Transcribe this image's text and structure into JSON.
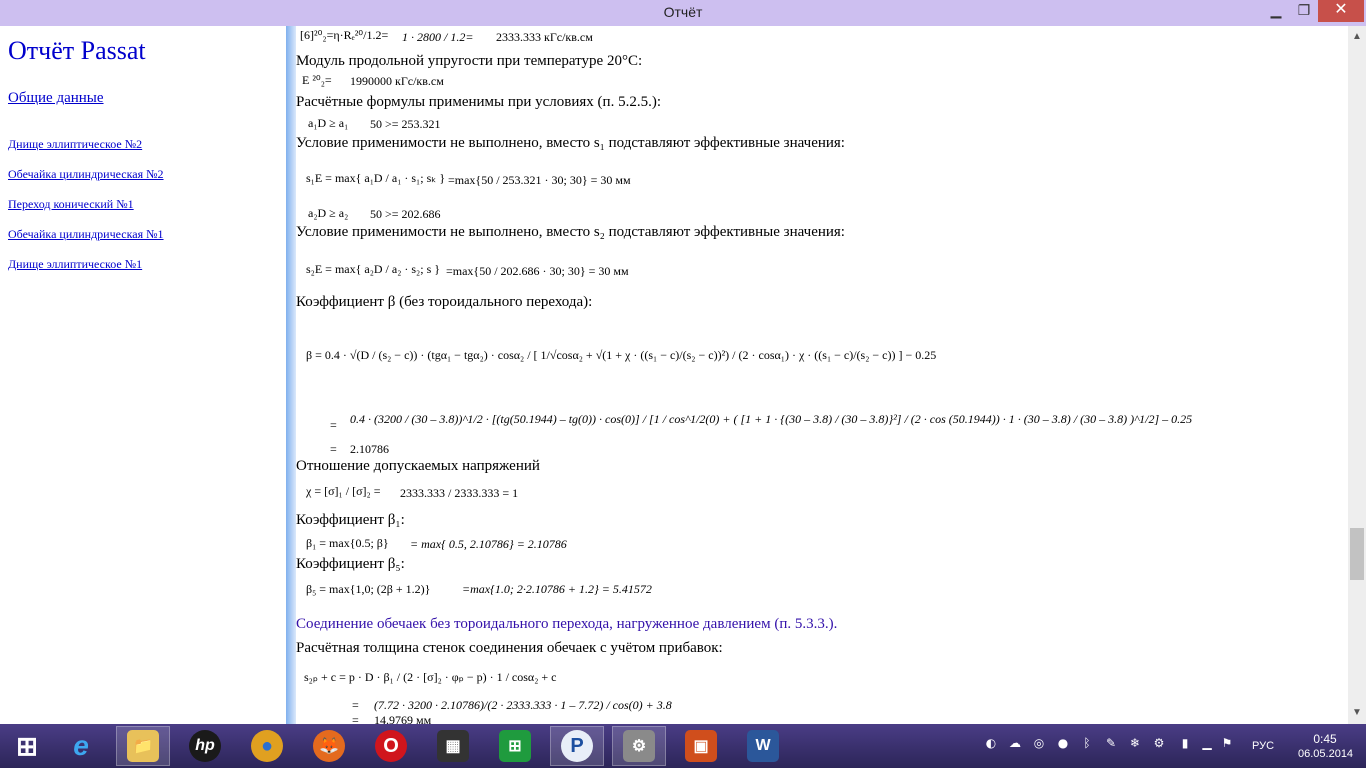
{
  "window": {
    "title": "Отчёт",
    "minimize": "▁",
    "maximize": "❐",
    "close": "✕"
  },
  "sidebar": {
    "app_title": "Отчёт Passat",
    "general_link": "Общие данные",
    "items": [
      "Днище эллиптическое №2",
      "Обечайка цилиндрическая №2",
      "Переход конический №1",
      "Обечайка цилиндрическая №1",
      "Днище эллиптическое №1"
    ]
  },
  "content": {
    "l01": "[6]²⁰₂=η·Rₑ²⁰/1.2=",
    "l01b": "1 · 2800 / 1.2=",
    "l01c": "2333.333 кГс/кв.см",
    "h02": "Модуль продольной упругости при температуре 20°С:",
    "l03": "E ²⁰₂=",
    "l03b": "1990000 кГс/кв.см",
    "h04": "Расчётные формулы применимы при условиях (п. 5.2.5.):",
    "l05": "a₁D ≥ a₁",
    "l05b": "50 >= 253.321",
    "h06": "Условие применимости не выполнено, вместо s₁ подставляют эффективные значения:",
    "l07": "s₁E = max{ a₁D / a₁ · s₁; sₖ }",
    "l07b": "=max{50 / 253.321 · 30; 30} = 30 мм",
    "l08": "a₂D ≥ a₂",
    "l08b": "50 >= 202.686",
    "h09": "Условие применимости не выполнено, вместо s₂ подставляют эффективные значения:",
    "l10": "s₂E = max{ a₂D / a₂ · s₂; s }",
    "l10b": "=max{50 / 202.686 · 30; 30} = 30 мм",
    "h11": "Коэффициент β (без тороидального перехода):",
    "l12": "β   =   0.4 · √(D / (s₂ − c)) · (tgα₁ − tgα₂) · cosα₂ / [ 1/√cosα₂ + √(1 + χ · ((s₁ − c)/(s₂ − c))²) / (2 · cosα₁) · χ · ((s₁ − c)/(s₂ − c)) ] − 0.25",
    "l13": "=",
    "l13b": "0.4 · (3200 / (30 – 3.8))^1/2 · [(tg(50.1944) – tg(0)) · cos(0)] / [1 / cos^1/2(0) + ( [1 + 1 · {(30 – 3.8) / (30 – 3.8)}²] / (2 · cos (50.1944)) · 1 · (30 – 3.8) / (30 – 3.8) )^1/2] – 0.25",
    "l14": "=",
    "l14b": "2.10786",
    "h15": "Отношение допускаемых напряжений",
    "l16": "χ = [σ]₁ / [σ]₂ =",
    "l16b": "2333.333 / 2333.333 = 1",
    "h17": "Коэффициент β₁:",
    "l18": "β₁ = max{0.5; β}",
    "l18b": "= max{ 0.5, 2.10786} = 2.10786",
    "h19": "Коэффициент β₅:",
    "l20": "β₅ = max{1,0;   (2β + 1.2)}",
    "l20b": "=max{1.0;  2·2.10786 + 1.2} = 5.41572",
    "h21": "Соединение обечаек без тороидального перехода, нагруженное давлением (п. 5.3.3.).",
    "h22": "Расчётная толщина стенок соединения обечаек с учётом прибавок:",
    "l23": "s₂ₚ + c   =   p · D · β₁ / (2 · [σ]₂ · φₚ − p) · 1 / cosα₂ + c",
    "l24": "=",
    "l24b": "(7.72 · 3200 · 2.10786)/(2 · 2333.333 · 1 – 7.72) / cos(0) + 3.8",
    "l25": "=",
    "l25b": "14.9769 мм"
  },
  "taskbar": {
    "start": "⊞",
    "apps": [
      "e",
      "📁",
      "hp",
      "●",
      "🦊",
      "O",
      "▦",
      "⊞",
      "P",
      "⚙",
      "▣",
      "W"
    ],
    "lang": "РУС",
    "time": "0:45",
    "date": "06.05.2014"
  },
  "colors": {
    "title_bar": "#cdbff0",
    "link": "#0000cc",
    "section": "#3311aa",
    "close": "#c7504a",
    "taskbar": "#3a3170"
  }
}
